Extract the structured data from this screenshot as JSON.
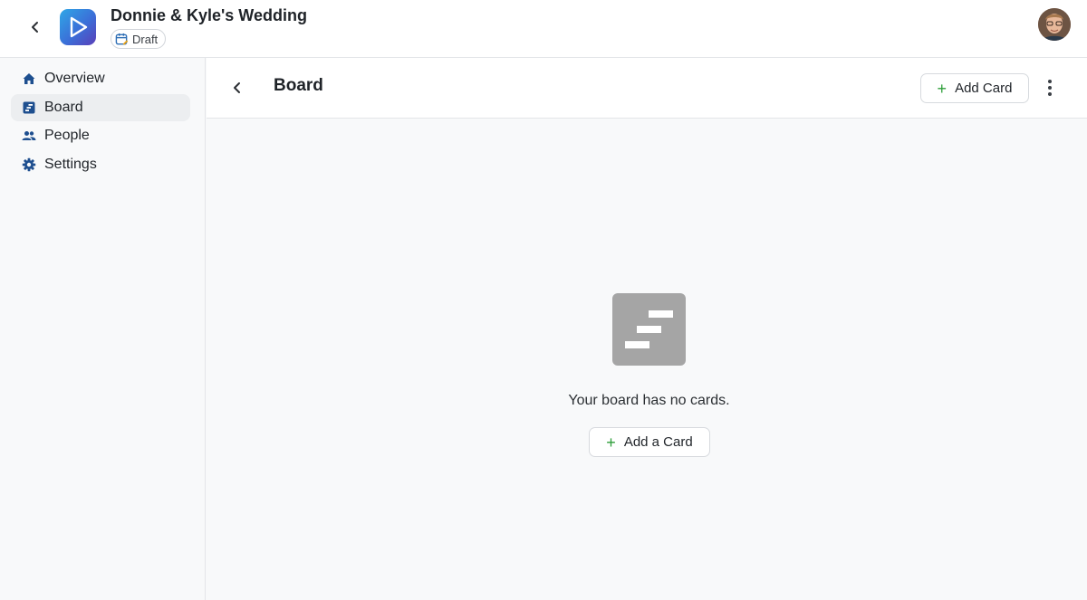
{
  "topbar": {
    "event_title": "Donnie & Kyle's Wedding",
    "status": "Draft",
    "back_icon": "chevron-left-icon",
    "logo_icon": "play-logo-icon",
    "status_icon": "calendar-edit-icon",
    "avatar_icon": "user-avatar"
  },
  "sidebar": {
    "items": [
      {
        "label": "Overview",
        "icon": "home-icon",
        "active": false
      },
      {
        "label": "Board",
        "icon": "board-icon",
        "active": true
      },
      {
        "label": "People",
        "icon": "people-icon",
        "active": false
      },
      {
        "label": "Settings",
        "icon": "gear-icon",
        "active": false
      }
    ]
  },
  "main": {
    "title": "Board",
    "add_card_label": "Add Card",
    "more_icon": "kebab-menu-icon",
    "empty_state": {
      "icon": "board-placeholder-icon",
      "message": "Your board has no cards.",
      "button_label": "Add a Card"
    }
  },
  "colors": {
    "accent_nav_icon": "#1e4f8f",
    "plus_green": "#2e9e3a",
    "placeholder_gray": "#a5a5a5",
    "active_nav_bg": "#eceef0"
  }
}
